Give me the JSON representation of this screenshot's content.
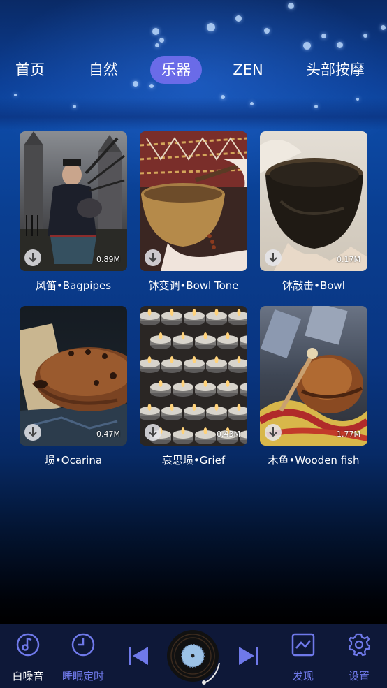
{
  "tabs": [
    {
      "label": "首页",
      "active": false
    },
    {
      "label": "自然",
      "active": false
    },
    {
      "label": "乐器",
      "active": true
    },
    {
      "label": "ZEN",
      "active": false
    },
    {
      "label": "头部按摩",
      "active": false
    }
  ],
  "items": [
    {
      "title": "风笛•Bagpipes",
      "size": "0.89M"
    },
    {
      "title": "钵变调•Bowl Tone",
      "size": ""
    },
    {
      "title": "钵敲击•Bowl",
      "size": "0.17M"
    },
    {
      "title": "埙•Ocarina",
      "size": "0.47M"
    },
    {
      "title": "哀思埙•Grief",
      "size": "0.43M"
    },
    {
      "title": "木鱼•Wooden fish",
      "size": "1.77M"
    }
  ],
  "bottom_nav": {
    "white_noise": "白噪音",
    "sleep_timer": "睡眠定时",
    "discover": "发现",
    "settings": "设置"
  },
  "colors": {
    "accent": "#6a6be8",
    "nav_icon": "#6f79ea",
    "bar_bg": "#0e1838"
  }
}
